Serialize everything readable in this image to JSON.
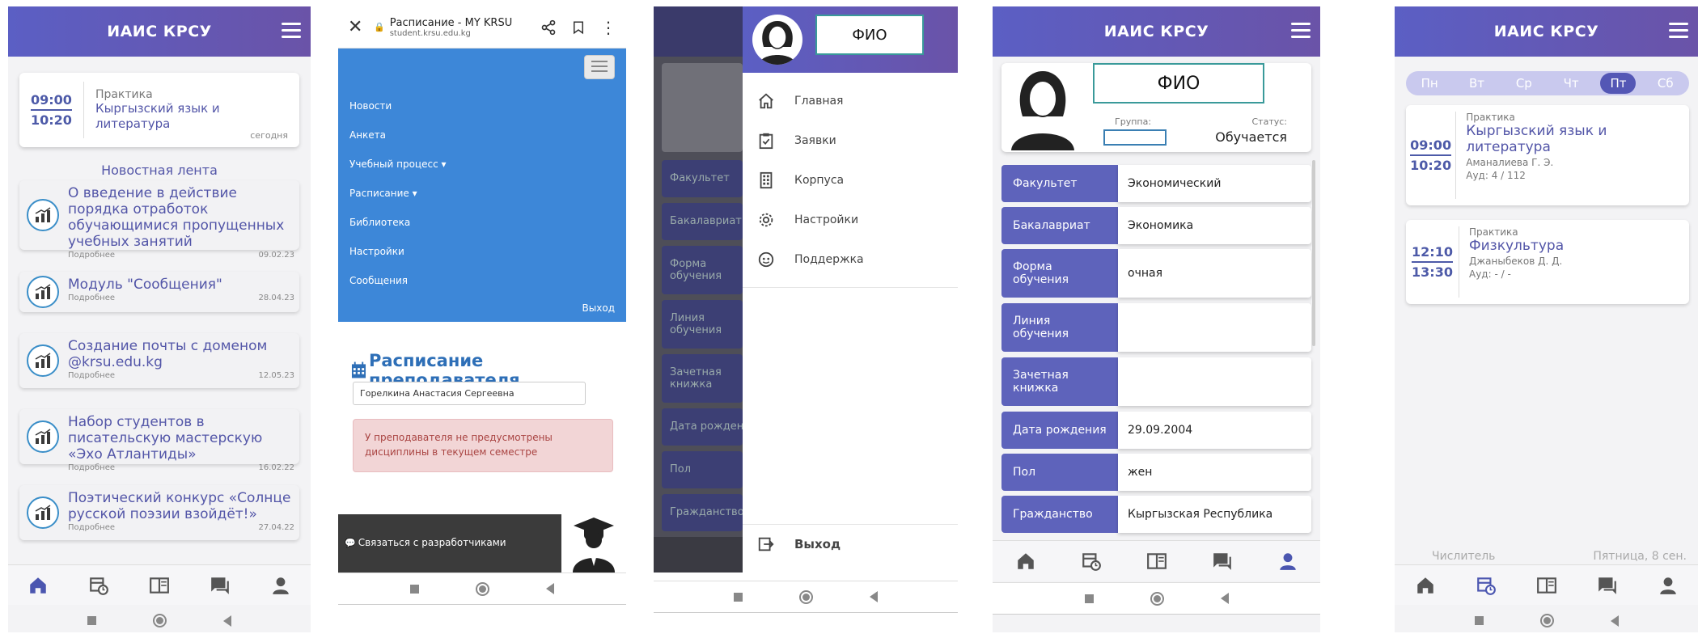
{
  "p1": {
    "header_title": "ИАИС КРСУ",
    "lesson": {
      "start": "09:00",
      "end": "10:20",
      "type": "Практика",
      "subject": "Кыргызский язык и литература",
      "when": "сегодня"
    },
    "news_heading": "Новостная лента",
    "news": [
      {
        "title": "О введение в действие порядка отработок обучающимися пропущенных учебных занятий",
        "more": "Подробнее",
        "date": "09.02.23"
      },
      {
        "title": "Модуль \"Сообщения\"",
        "more": "Подробнее",
        "date": "28.04.23"
      },
      {
        "title": "Создание почты с доменом @krsu.edu.kg",
        "more": "Подробнее",
        "date": "12.05.23"
      },
      {
        "title": "Набор студентов в писательскую мастерскую «Эхо Атлантиды»",
        "more": "Подробнее",
        "date": "16.02.22"
      },
      {
        "title": "Поэтический конкурс «Солнце русской поэзии взойдёт!»",
        "more": "Подробнее",
        "date": "27.04.22"
      }
    ]
  },
  "p2": {
    "page_title": "Расписание - MY KRSU",
    "url": "student.krsu.edu.kg",
    "menu": [
      "Новости",
      "Анкета",
      "Учебный процесс ▾",
      "Расписание ▾",
      "Библиотека",
      "Настройки",
      "Сообщения"
    ],
    "logout": "Выход",
    "heading": "Расписание преподавателя",
    "teacher_value": "Горелкина Анастасия Сергеевна",
    "alert": "У преподавателя не предусмотрены дисциплины в текущем семестре",
    "footer_link": "Связаться с разработчиками"
  },
  "p3": {
    "fio": "ФИО",
    "items": [
      "Главная",
      "Заявки",
      "Корпуса",
      "Настройки",
      "Поддержка"
    ],
    "logout": "Выход",
    "bg_labels": [
      "Факультет",
      "Бакалавриат",
      "Форма обучения",
      "Линия обучения",
      "Зачетная книжка",
      "Дата рождения",
      "Пол",
      "Гражданство"
    ]
  },
  "p4": {
    "header_title": "ИАИС КРСУ",
    "fio": "ФИО",
    "group_label": "Группа:",
    "status_label": "Статус:",
    "status_value": "Обучается",
    "rows": [
      {
        "label": "Факультет",
        "value": "Экономический"
      },
      {
        "label": "Бакалавриат",
        "value": "Экономика"
      },
      {
        "label": "Форма обучения",
        "value": "очная"
      },
      {
        "label": "Линия обучения",
        "value": ""
      },
      {
        "label": "Зачетная книжка",
        "value": ""
      },
      {
        "label": "Дата рождения",
        "value": "29.09.2004"
      },
      {
        "label": "Пол",
        "value": "жен"
      },
      {
        "label": "Гражданство",
        "value": "Кыргызская Республика"
      }
    ]
  },
  "p5": {
    "header_title": "ИАИС КРСУ",
    "days": [
      "Пн",
      "Вт",
      "Ср",
      "Чт",
      "Пт",
      "Сб"
    ],
    "active_day": "Пт",
    "lessons": [
      {
        "start": "09:00",
        "end": "10:20",
        "type": "Практика",
        "subject": "Кыргызский язык и литература",
        "teacher": "Аманалиева Г. Э.",
        "room": "Ауд: 4 / 112"
      },
      {
        "start": "12:10",
        "end": "13:30",
        "type": "Практика",
        "subject": "Физкультура",
        "teacher": "Джаныбеков Д. Д.",
        "room": "Ауд: - / -"
      }
    ],
    "week_type": "Числитель",
    "date": "Пятница, 8 сен."
  },
  "colors": {
    "primary": "#5e63bb",
    "header_from": "#5b5fc4",
    "header_to": "#6a53a8",
    "browser_blue": "#3d87d8",
    "alert_bg": "#f2d5d6"
  }
}
